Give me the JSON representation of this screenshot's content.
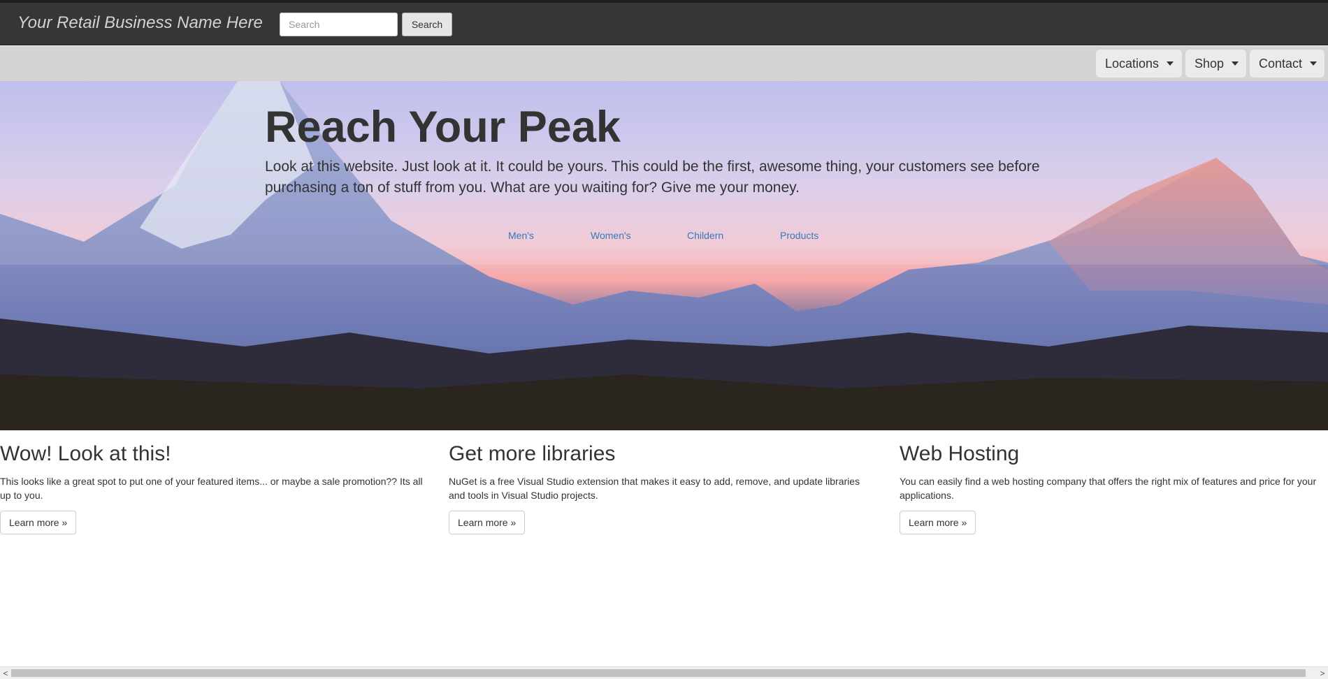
{
  "header": {
    "brand": "Your Retail Business Name Here",
    "search_placeholder": "Search",
    "search_button": "Search"
  },
  "subnav": {
    "items": [
      {
        "label": "Locations"
      },
      {
        "label": "Shop"
      },
      {
        "label": "Contact"
      }
    ]
  },
  "hero": {
    "title": "Reach Your Peak",
    "text": "Look at this website. Just look at it. It could be yours. This could be the first, awesome thing, your customers see before purchasing a ton of stuff from you. What are you waiting for? Give me your money.",
    "links": [
      {
        "label": "Men's"
      },
      {
        "label": "Women's"
      },
      {
        "label": "Childern"
      },
      {
        "label": "Products"
      }
    ]
  },
  "features": [
    {
      "title": "Wow! Look at this!",
      "text": "This looks like a great spot to put one of your featured items... or maybe a sale promotion?? Its all up to you.",
      "button": "Learn more »"
    },
    {
      "title": "Get more libraries",
      "text": "NuGet is a free Visual Studio extension that makes it easy to add, remove, and update libraries and tools in Visual Studio projects.",
      "button": "Learn more »"
    },
    {
      "title": "Web Hosting",
      "text": "You can easily find a web hosting company that offers the right mix of features and price for your applications.",
      "button": "Learn more »"
    }
  ],
  "scrollbar": {
    "left_arrow": "<",
    "right_arrow": ">"
  }
}
